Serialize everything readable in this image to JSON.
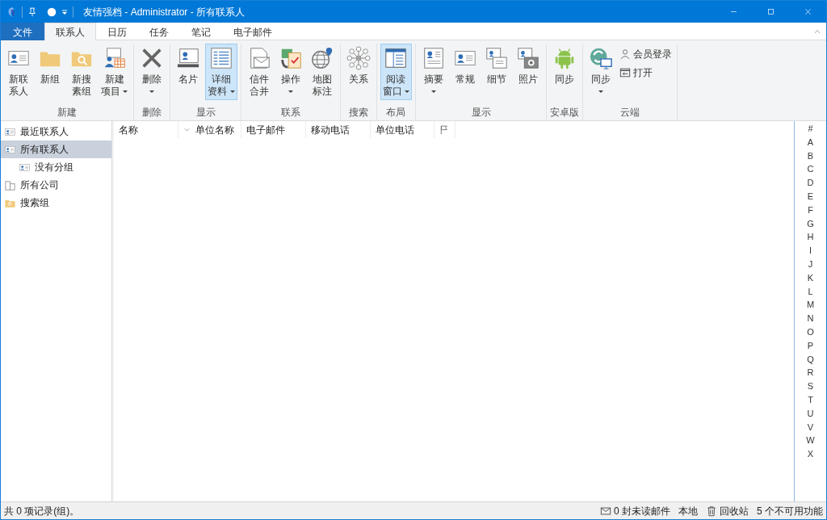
{
  "window": {
    "title": "友情强档 - Administrator - 所有联系人"
  },
  "tabs": [
    {
      "label": "文件",
      "kind": "file",
      "selected": false
    },
    {
      "label": "联系人",
      "kind": "tab",
      "selected": true
    },
    {
      "label": "日历",
      "kind": "tab",
      "selected": false
    },
    {
      "label": "任务",
      "kind": "tab",
      "selected": false
    },
    {
      "label": "笔记",
      "kind": "tab",
      "selected": false
    },
    {
      "label": "电子邮件",
      "kind": "tab",
      "selected": false
    }
  ],
  "ribbon": {
    "groups": [
      {
        "label": "新建",
        "buttons": [
          {
            "lines": [
              "新联",
              "系人"
            ],
            "kind": "plain",
            "selected": false
          },
          {
            "lines": [
              "新组"
            ],
            "kind": "plain",
            "selected": false
          },
          {
            "lines": [
              "新搜",
              "素组"
            ],
            "kind": "plain",
            "selected": false
          },
          {
            "lines": [
              "新建",
              "项目"
            ],
            "kind": "split",
            "selected": false
          }
        ]
      },
      {
        "label": "删除",
        "buttons": [
          {
            "lines": [
              "删除"
            ],
            "kind": "menu",
            "selected": false
          }
        ]
      },
      {
        "label": "显示",
        "buttons": [
          {
            "lines": [
              "名片"
            ],
            "kind": "plain",
            "selected": false
          },
          {
            "lines": [
              "详细",
              "资料"
            ],
            "kind": "split",
            "selected": true
          }
        ]
      },
      {
        "label": "联系",
        "buttons": [
          {
            "lines": [
              "信件",
              "合并"
            ],
            "kind": "plain",
            "selected": false
          },
          {
            "lines": [
              "操作"
            ],
            "kind": "menu",
            "selected": false
          },
          {
            "lines": [
              "地图",
              "标注"
            ],
            "kind": "plain",
            "selected": false
          }
        ]
      },
      {
        "label": "搜索",
        "buttons": [
          {
            "lines": [
              "关系"
            ],
            "kind": "plain",
            "selected": false
          }
        ]
      },
      {
        "label": "布局",
        "buttons": [
          {
            "lines": [
              "阅读",
              "窗口"
            ],
            "kind": "split",
            "selected": true
          }
        ]
      },
      {
        "label": "显示",
        "buttons": [
          {
            "lines": [
              "摘要"
            ],
            "kind": "menu",
            "selected": false
          },
          {
            "lines": [
              "常规"
            ],
            "kind": "plain",
            "selected": false
          },
          {
            "lines": [
              "细节"
            ],
            "kind": "plain",
            "selected": false
          },
          {
            "lines": [
              "照片"
            ],
            "kind": "plain",
            "selected": false
          }
        ]
      },
      {
        "label": "安卓版",
        "buttons": [
          {
            "lines": [
              "同步"
            ],
            "kind": "plain",
            "selected": false
          }
        ]
      },
      {
        "label": "云端",
        "buttons": [
          {
            "lines": [
              "同步"
            ],
            "kind": "menu",
            "selected": false
          }
        ],
        "small_buttons": [
          {
            "label": "会员登录"
          },
          {
            "label": "打开"
          }
        ]
      }
    ]
  },
  "sidebar": {
    "items": [
      {
        "label": "最近联系人",
        "selected": false
      },
      {
        "label": "所有联系人",
        "selected": true,
        "children": [
          {
            "label": "没有分组",
            "selected": false
          }
        ]
      },
      {
        "label": "所有公司",
        "selected": false
      },
      {
        "label": "搜索组",
        "selected": false
      }
    ]
  },
  "table": {
    "columns": [
      {
        "label": "名称",
        "kind": "text",
        "sort_indicator": false
      },
      {
        "label": "单位名称",
        "kind": "text",
        "sort_indicator": true
      },
      {
        "label": "电子邮件",
        "kind": "text",
        "sort_indicator": false
      },
      {
        "label": "移动电话",
        "kind": "text",
        "sort_indicator": false
      },
      {
        "label": "单位电话",
        "kind": "text",
        "sort_indicator": false
      },
      {
        "kind": "flag",
        "sort_indicator": false
      }
    ]
  },
  "index_bar": [
    "#",
    "A",
    "B",
    "C",
    "D",
    "E",
    "F",
    "G",
    "H",
    "I",
    "J",
    "K",
    "L",
    "M",
    "N",
    "O",
    "P",
    "Q",
    "R",
    "S",
    "T",
    "U",
    "V",
    "W",
    "X"
  ],
  "status_bar": {
    "left": "共 0 项记录(组)。",
    "right": [
      {
        "text": "0 封未读邮件",
        "kind": "mail"
      },
      {
        "text": "本地",
        "kind": "plain"
      },
      {
        "text": "回收站",
        "kind": "trash"
      },
      {
        "text": "5 个不可用功能",
        "kind": "plain"
      }
    ]
  }
}
